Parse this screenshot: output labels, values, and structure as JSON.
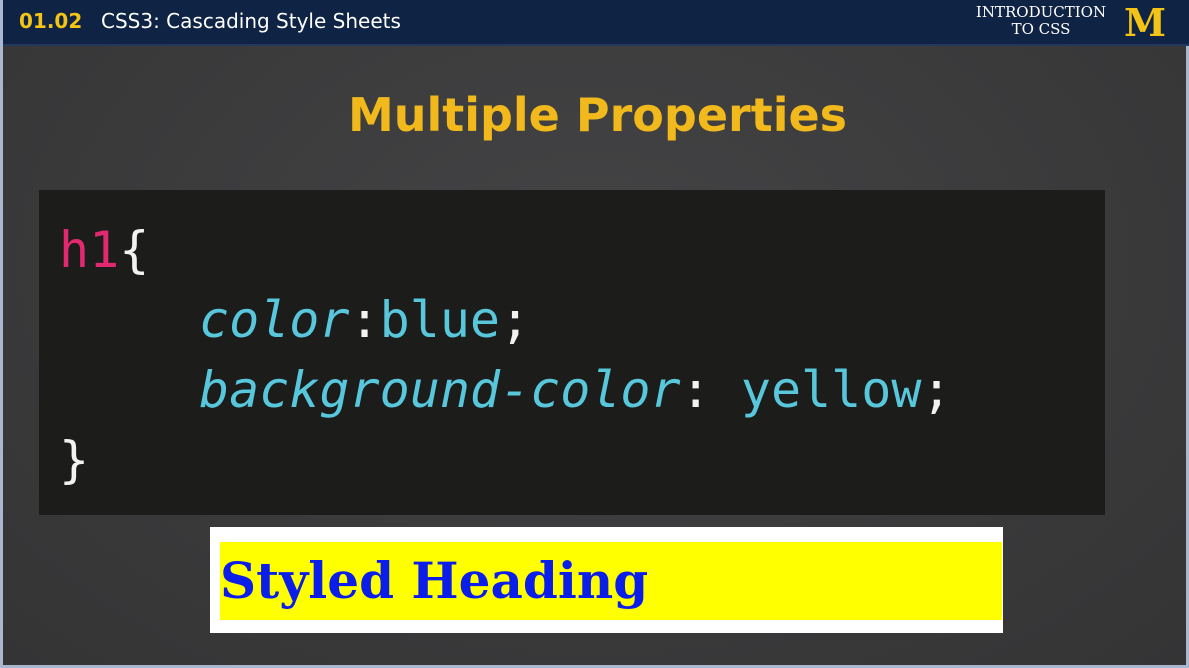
{
  "header": {
    "lesson_number": "01.02",
    "lesson_title": "CSS3: Cascading Style Sheets",
    "course_label_line1": "INTRODUCTION",
    "course_label_line2": "TO CSS",
    "logo_text": "M"
  },
  "slide": {
    "title": "Multiple Properties",
    "code": {
      "selector": "h1",
      "open_brace": "{",
      "line1_property": "color",
      "line1_colon": ":",
      "line1_value": "blue",
      "line1_semicolon": ";",
      "line2_property": "background-color",
      "line2_colon": ":",
      "line2_value": " yellow",
      "line2_semicolon": ";",
      "close_brace": "}"
    },
    "demo_heading": "Styled Heading"
  },
  "colors": {
    "header_bg": "#0f2344",
    "accent_gold": "#f3c316",
    "title_gold": "#f1b91b",
    "code_bg": "#1c1c1b",
    "selector_pink": "#e22970",
    "property_cyan": "#58c7dc",
    "demo_blue": "#0b1de8",
    "demo_yellow": "#ffff00"
  }
}
